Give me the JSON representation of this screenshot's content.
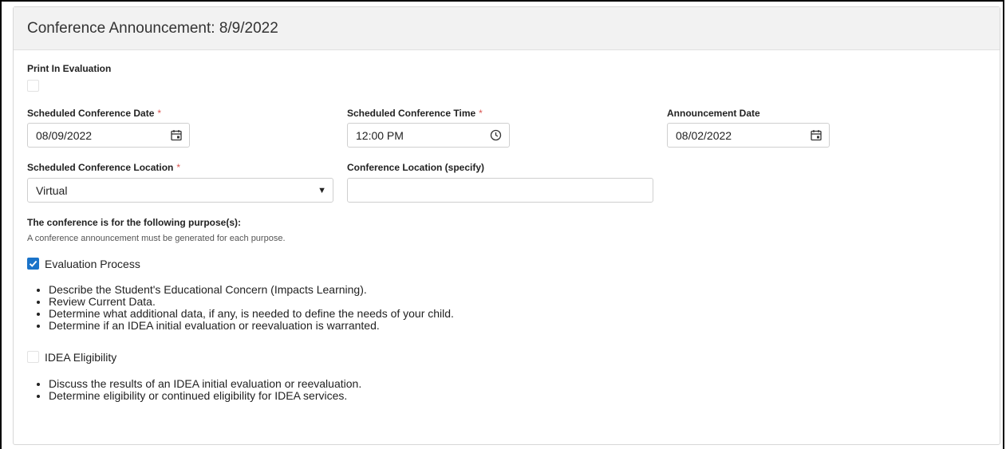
{
  "panel": {
    "title": "Conference Announcement: 8/9/2022"
  },
  "print_in_evaluation": {
    "label": "Print In Evaluation",
    "checked": false
  },
  "scheduled_date": {
    "label": "Scheduled Conference Date",
    "required_mark": "*",
    "value": "08/09/2022",
    "icon": "calendar-icon"
  },
  "scheduled_time": {
    "label": "Scheduled Conference Time",
    "required_mark": "*",
    "value": "12:00 PM",
    "icon": "clock-icon"
  },
  "announcement_date": {
    "label": "Announcement Date",
    "value": "08/02/2022",
    "icon": "calendar-icon"
  },
  "location": {
    "label": "Scheduled Conference Location",
    "required_mark": "*",
    "value": "Virtual",
    "icon": "caret-down-icon"
  },
  "location_specify": {
    "label": "Conference Location (specify)",
    "value": ""
  },
  "purposes": {
    "heading": "The conference is for the following purpose(s):",
    "help": "A conference announcement must be generated for each purpose.",
    "options": [
      {
        "label": "Evaluation Process",
        "checked": true,
        "bullets": [
          "Describe the Student's Educational Concern (Impacts Learning).",
          "Review Current Data.",
          "Determine what additional data, if any, is needed to define the needs of your child.",
          "Determine if an IDEA initial evaluation or reevaluation is warranted."
        ]
      },
      {
        "label": "IDEA Eligibility",
        "checked": false,
        "bullets": [
          "Discuss the results of an IDEA initial evaluation or reevaluation.",
          "Determine eligibility or continued eligibility for IDEA services."
        ]
      }
    ]
  },
  "colors": {
    "accent": "#1a73c9",
    "required": "#d9534f",
    "header_bg": "#f2f2f2"
  }
}
